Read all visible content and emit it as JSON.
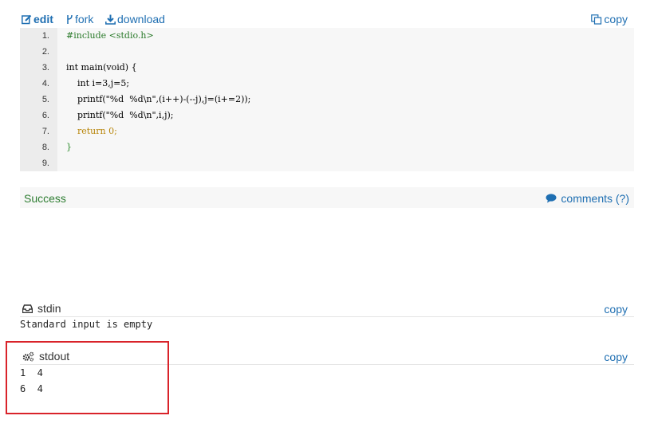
{
  "toolbar": {
    "edit_label": "edit",
    "fork_label": "fork",
    "download_label": "download",
    "copy_label": "copy"
  },
  "code": {
    "lines": [
      {
        "num": "1.",
        "text": "#include <stdio.h>"
      },
      {
        "num": "2.",
        "text": ""
      },
      {
        "num": "3.",
        "text": "int main(void) {"
      },
      {
        "num": "4.",
        "text": "    int i=3,j=5;"
      },
      {
        "num": "5.",
        "text": "    printf(\"%d  %d\\n\",(i++)-(--j),j=(i+=2));"
      },
      {
        "num": "6.",
        "text": "    printf(\"%d  %d\\n\",i,j);"
      },
      {
        "num": "7.",
        "text": "    return 0;"
      },
      {
        "num": "8.",
        "text": "}"
      },
      {
        "num": "9.",
        "text": ""
      }
    ]
  },
  "status": {
    "result": "Success",
    "comments_label": "comments (?)"
  },
  "stdin": {
    "title": "stdin",
    "copy_label": "copy",
    "content": "Standard input is empty"
  },
  "stdout": {
    "title": "stdout",
    "copy_label": "copy",
    "lines": [
      "1  4",
      "6  4"
    ]
  },
  "colors": {
    "link": "#1f6fb2",
    "success": "#2e7d32",
    "highlight_border": "#d9232a"
  },
  "icons": {
    "edit": "edit-icon",
    "fork": "fork-icon",
    "download": "download-icon",
    "copy": "copy-icon",
    "comments": "comment-bubble-icon",
    "stdin": "inbox-icon",
    "stdout": "gears-icon"
  }
}
